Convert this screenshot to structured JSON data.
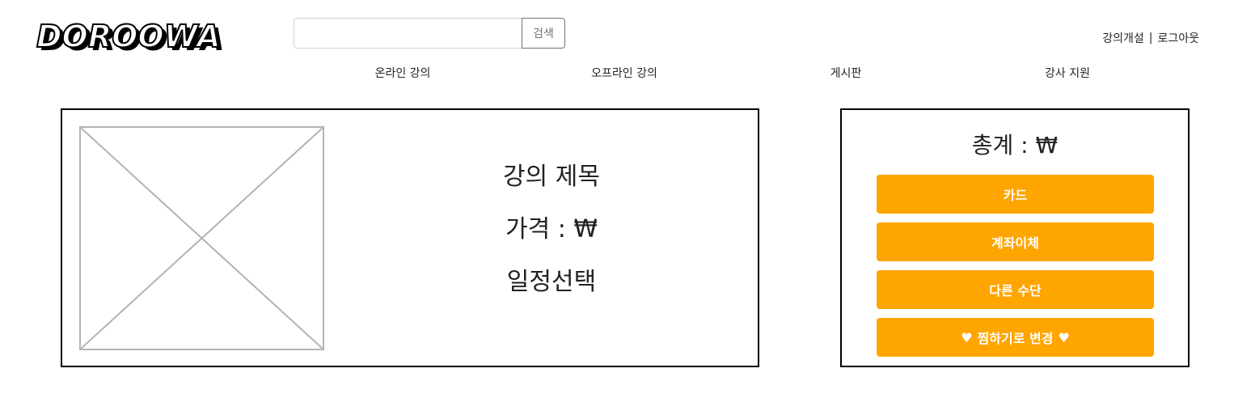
{
  "logo": {
    "text": "DOROOWA"
  },
  "search": {
    "placeholder": "",
    "value": "",
    "button_label": "검색"
  },
  "user_links": {
    "open_course": "강의개설",
    "separator": "|",
    "logout": "로그아웃"
  },
  "nav": {
    "items": [
      {
        "label": "온라인 강의"
      },
      {
        "label": "오프라인 강의"
      },
      {
        "label": "게시판"
      },
      {
        "label": "강사 지원"
      }
    ]
  },
  "course": {
    "image": "image-placeholder-icon",
    "title": "강의 제목",
    "price": "가격 : ₩",
    "schedule": "일정선택"
  },
  "payment": {
    "total": "총계 : ₩",
    "buttons": [
      {
        "label": "카드"
      },
      {
        "label": "계좌이체"
      },
      {
        "label": "다른 수단"
      },
      {
        "label": "찜하기로 변경"
      }
    ],
    "wishlist_icon": "heart-icon"
  },
  "colors": {
    "accent": "#FFA500",
    "border": "#000000",
    "placeholder_stroke": "#b3b3b3"
  }
}
